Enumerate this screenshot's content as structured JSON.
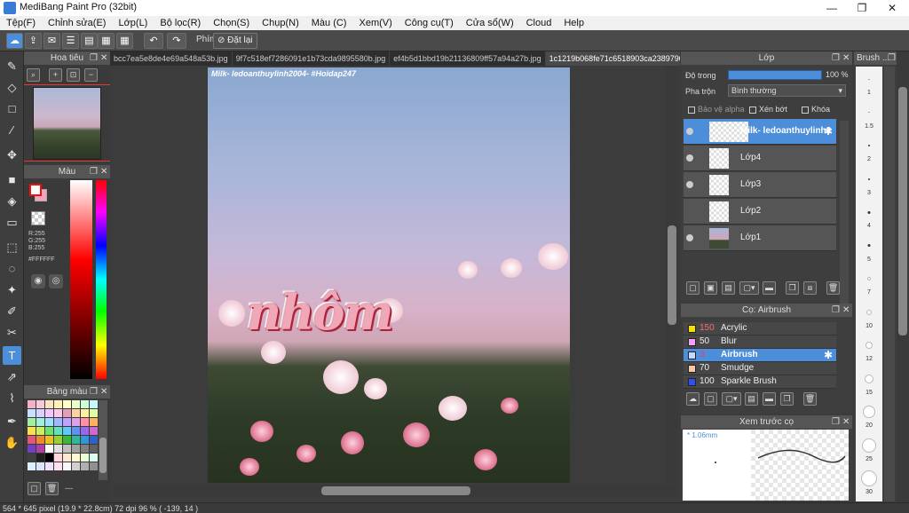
{
  "window": {
    "title": "MediBang Paint Pro (32bit)",
    "minimize": "—",
    "maximize": "❐",
    "close": "✕"
  },
  "menu": [
    "Tệp(F)",
    "Chỉnh sửa(E)",
    "Lớp(L)",
    "Bộ lọc(R)",
    "Chọn(S)",
    "Chụp(N)",
    "Màu (C)",
    "Xem(V)",
    "Công cụ(T)",
    "Cửa sổ(W)",
    "Cloud",
    "Help"
  ],
  "toolbar": {
    "shortcut_label": "Phím",
    "reset_label": "Đặt lại"
  },
  "navigator": {
    "title": "Hoa tiêu"
  },
  "color": {
    "title": "Màu",
    "r": "R:255",
    "g": "G:255",
    "b": "B:255",
    "hex": "#FFFFFF",
    "fg": "#ffffff",
    "bg": "#f4a4b8"
  },
  "swatches": {
    "title": "Bảng màu",
    "colors": [
      "#f4b0c4",
      "#f6c8d8",
      "#fde4c0",
      "#fff4b8",
      "#ffffc8",
      "#e8ffc8",
      "#d0ffd8",
      "#c8f8ff",
      "#c8e0ff",
      "#d8d0ff",
      "#f0c8ff",
      "#ffc8e8",
      "#e0a0b8",
      "#ffd0a0",
      "#fff0a0",
      "#e0ffa0",
      "#a0f0a0",
      "#a0f0e0",
      "#a0e0ff",
      "#a0b8ff",
      "#c0a0ff",
      "#e0a0e8",
      "#ff90a8",
      "#ffb060",
      "#f8e050",
      "#c8f060",
      "#70e070",
      "#60e0c0",
      "#60c8f8",
      "#6090f0",
      "#9868e8",
      "#d068d0",
      "#e05878",
      "#f08830",
      "#e8c020",
      "#98d030",
      "#38b838",
      "#30b898",
      "#3098d8",
      "#3060c8",
      "#7040c0",
      "#b040a8",
      "#ffffff",
      "#e0e0e0",
      "#c0c0c0",
      "#a0a0a0",
      "#808080",
      "#606060",
      "#404040",
      "#202020",
      "#000000",
      "#ffd8e0",
      "#ffe8d0",
      "#fff8d0",
      "#e8ffd8",
      "#d8fff0",
      "#d8f0ff",
      "#e0e0ff",
      "#f0e0ff",
      "#ffe0f0",
      "#f8f8f8",
      "#d0d0d0",
      "#b0b0b0",
      "#909090"
    ]
  },
  "tabs": [
    "bcc7ea5e8de4e69a548a53b.jpg",
    "9f7c518ef7286091e1b73cda9895580b.jpg",
    "ef4b5d1bbd19b21136809ff57a94a27b.jpg",
    "1c1219b068fe71c6518903ca23897904.jpg"
  ],
  "canvas": {
    "watermark": "Milk- ledoanthuylinh2004- #Hoidap247",
    "art_text": "nhôm"
  },
  "layers": {
    "title": "Lớp",
    "opacity_label": "Độ trong",
    "opacity_value": "100 %",
    "blend_label": "Pha trộn",
    "blend_value": "Bình thường",
    "alpha_label": "Bảo vệ alpha",
    "clip_label": "Xén bớt",
    "lock_label": "Khóa",
    "items": [
      {
        "name": "Milk- ledoanthuylinh2",
        "active": true
      },
      {
        "name": "Lớp4",
        "active": false
      },
      {
        "name": "Lớp3",
        "active": false
      },
      {
        "name": "Lớp2",
        "active": false
      },
      {
        "name": "Lớp1",
        "active": false
      }
    ]
  },
  "brushes": {
    "title": "Cọ: Airbrush",
    "items": [
      {
        "size": "150",
        "name": "Acrylic",
        "color": "#f2e000"
      },
      {
        "size": "50",
        "name": "Blur",
        "color": "#f4a0ff"
      },
      {
        "size": "3",
        "name": "Airbrush",
        "color": "#c8d8ff"
      },
      {
        "size": "70",
        "name": "Smudge",
        "color": "#f4c8a8"
      },
      {
        "size": "100",
        "name": "Sparkle Brush",
        "color": "#3050f0"
      }
    ]
  },
  "preview": {
    "title": "Xem trước cọ",
    "size": "* 1.06mm"
  },
  "brush_size": {
    "title": "Brush ...",
    "sizes": [
      "1",
      "1.5",
      "2",
      "3",
      "4",
      "5",
      "7",
      "10",
      "12",
      "15",
      "20",
      "25",
      "30"
    ]
  },
  "status": {
    "text": "564 * 645 pixel   (19.9 * 22.8cm)   72 dpi   96 %   ( -139, 14 )"
  }
}
